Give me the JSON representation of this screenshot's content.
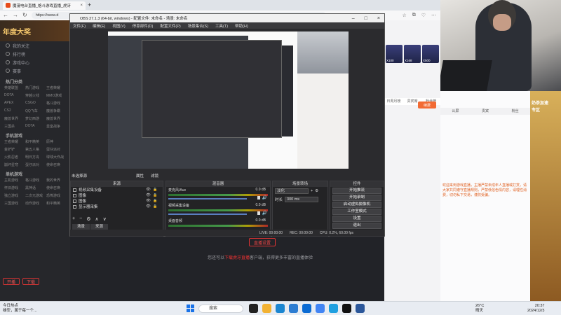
{
  "browser": {
    "tab_title": "魔漫电台直播_格斗游戏直播_虎牙",
    "tab_close": "×",
    "new_tab": "+",
    "url": "https://www.d",
    "nav": {
      "back": "←",
      "forward": "→",
      "reload": "↻"
    },
    "toolbar_icons": [
      "☆",
      "⧉",
      "♡",
      "⋯"
    ]
  },
  "site_sidebar": {
    "logo": "年度大奖",
    "items": [
      "我的关注",
      "排行榜",
      "游戏中心",
      "赛事"
    ],
    "section_hot": "热门分类",
    "hot_grid": [
      "英雄联盟",
      "热门游戏",
      "王者荣耀",
      "DOTA",
      "穿越火线",
      "MMO游戏",
      "APEX",
      "CSGO",
      "格斗游戏",
      "CS2",
      "QQ飞车",
      "魔兽争霸",
      "魔兽世界",
      "梦幻西游",
      "魔兽世界",
      "三国杀",
      "DOTA",
      "皇室战争"
    ],
    "section_mobile": "手机游戏",
    "mobile_grid": [
      "王者荣耀",
      "和平精英",
      "原神",
      "金铲铲",
      "第五人格",
      "蛋仔派对",
      "火影忍者",
      "明日方舟",
      "球球大作战",
      "崩坏星穹",
      "蛋仔派对",
      "使命召唤"
    ],
    "section_game": "单机游戏",
    "game_grid": [
      "主机游戏",
      "格斗游戏",
      "我的世界",
      "怀旧游戏",
      "黑神话",
      "使命召唤",
      "独立游戏",
      "二次元游戏",
      "恐怖游戏",
      "三国游戏",
      "动作游戏",
      "和平精英"
    ],
    "btn_open": "开播",
    "btn_download": "下载"
  },
  "center": {
    "live_button": "直播设置",
    "hint_prefix": "您还可以",
    "hint_link": "下载虎牙直播",
    "hint_suffix": "客户端，获得更多丰富的直播体验"
  },
  "right_panel": {
    "gifts": [
      "X100",
      "X168",
      "X500"
    ],
    "user_tabs": [
      "日周月榜",
      "贵宾席",
      "粉丝榜"
    ],
    "buy_button": "续费"
  },
  "obs": {
    "title": "OBS 27.1.3 (64-bit, windows) - 配置文件: 未命名 - 场景: 未命名",
    "menu": [
      "文件(F)",
      "编辑(E)",
      "视图(V)",
      "停靠部件(D)",
      "配置文件(P)",
      "场景集合(S)",
      "工具(T)",
      "帮助(H)"
    ],
    "scene_label": "未选择源",
    "props_btn": "属性",
    "filters_btn": "滤镜",
    "docks": {
      "sources": "来源",
      "mixer": "混音器",
      "transitions": "场景转场",
      "controls": "控件"
    },
    "sources": [
      {
        "name": "视频采集设备"
      },
      {
        "name": "图像"
      },
      {
        "name": "图像"
      },
      {
        "name": "显示器采集"
      }
    ],
    "scene_tabs": [
      "场景",
      "来源"
    ],
    "mixer": [
      {
        "name": "麦克风/Aux",
        "db": "0.0 dB"
      },
      {
        "name": "视频采集设备",
        "db": "0.0 dB"
      },
      {
        "name": "桌面音频",
        "db": "0.0 dB"
      }
    ],
    "transition_select": "淡化",
    "duration_label": "时长",
    "duration_value": "300 ms",
    "controls": [
      "开始推流",
      "开始录制",
      "启动虚拟摄像机",
      "工作室模式",
      "设置",
      "退出"
    ],
    "status": [
      "LIVE: 00:00:00",
      "REC: 00:00:00",
      "CPU: 0.2%, 60.00 fps"
    ]
  },
  "chat": {
    "tabs": [
      "公屏",
      "贵宾",
      "粉丝"
    ],
    "notice": "欢迎来到游戏直播，主播严禁未成年人直播或打赏，请大家共同遵守直播规则，严禁低俗色情内容，请理性消费，切勿私下交易，谨防受骗。",
    "ad_title": "奶茶加速",
    "ad_sub": "专区"
  },
  "taskbar": {
    "weather_top": "今日热点",
    "weather_bottom": "雄安，属于每一个...",
    "search": "搜索",
    "temp": "26°C",
    "weather_desc": "晴天",
    "time": "20:37",
    "date": "2024/12/3"
  }
}
